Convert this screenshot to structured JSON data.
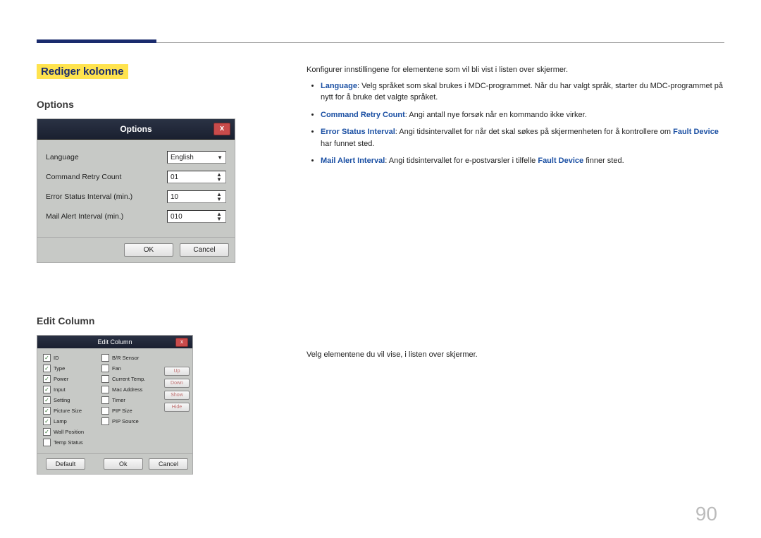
{
  "header": {
    "section_tag": "Rediger kolonne"
  },
  "options": {
    "heading": "Options",
    "dialog_title": "Options",
    "close_glyph": "x",
    "rows": {
      "language": {
        "label": "Language",
        "value": "English"
      },
      "retry": {
        "label": "Command Retry Count",
        "value": "01"
      },
      "error_interval": {
        "label": "Error Status Interval (min.)",
        "value": "10"
      },
      "mail_interval": {
        "label": "Mail Alert Interval (min.)",
        "value": "010"
      }
    },
    "ok": "OK",
    "cancel": "Cancel"
  },
  "edit_column": {
    "heading": "Edit Column",
    "dialog_title": "Edit Column",
    "col1": [
      {
        "label": "ID",
        "checked": true
      },
      {
        "label": "Type",
        "checked": true
      },
      {
        "label": "Power",
        "checked": true
      },
      {
        "label": "Input",
        "checked": true
      },
      {
        "label": "Setting",
        "checked": true
      },
      {
        "label": "Picture Size",
        "checked": true
      },
      {
        "label": "Lamp",
        "checked": true
      },
      {
        "label": "Wall Position",
        "checked": true
      },
      {
        "label": "Temp Status",
        "checked": false
      }
    ],
    "col2": [
      {
        "label": "B/R Sensor",
        "checked": false
      },
      {
        "label": "Fan",
        "checked": false
      },
      {
        "label": "Current Temp.",
        "checked": false
      },
      {
        "label": "Mac Address",
        "checked": false
      },
      {
        "label": "Timer",
        "checked": false
      },
      {
        "label": "PIP Size",
        "checked": false
      },
      {
        "label": "PIP Source",
        "checked": false
      }
    ],
    "side_buttons": {
      "up": "Up",
      "down": "Down",
      "show": "Show",
      "hide": "Hide"
    },
    "default": "Default",
    "ok": "Ok",
    "cancel": "Cancel"
  },
  "text": {
    "intro": "Konfigurer innstillingene for elementene som vil bli vist i listen over skjermer.",
    "language_kw": "Language",
    "language_rest": ": Velg språket som skal brukes i MDC-programmet. Når du har valgt språk, starter du MDC-programmet på nytt for å bruke det valgte språket.",
    "retry_kw": "Command Retry Count",
    "retry_rest": ": Angi antall nye forsøk når en kommando ikke virker.",
    "error_kw": "Error Status Interval",
    "error_mid": ": Angi tidsintervallet for når det skal søkes på skjermenheten for å kontrollere om ",
    "error_fault": "Fault Device",
    "error_end": " har funnet sted.",
    "mail_kw": "Mail Alert Interval",
    "mail_mid": ": Angi tidsintervallet for e-postvarsler i tilfelle ",
    "mail_fault": "Fault Device",
    "mail_end": " finner sted.",
    "edit_intro": "Velg elementene du vil vise, i listen over skjermer."
  },
  "page_number": "90"
}
